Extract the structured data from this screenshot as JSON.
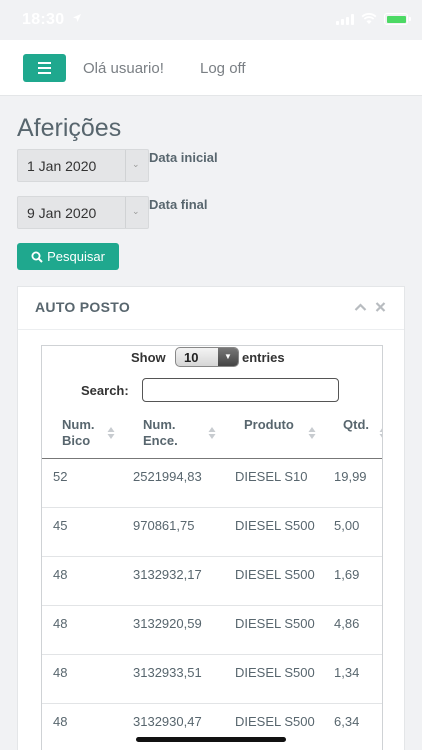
{
  "status_bar": {
    "time": "18:30"
  },
  "header": {
    "greeting": "Olá usuario!",
    "logoff": "Log off"
  },
  "page": {
    "title": "Aferições"
  },
  "filters": {
    "start_date": "1 Jan 2020",
    "start_label": "Data inicial",
    "end_date": "9 Jan 2020",
    "end_label": "Data final",
    "search_button": "Pesquisar"
  },
  "panel": {
    "title": "AUTO POSTO",
    "length_show": "Show",
    "length_value": "10",
    "length_entries": "entries",
    "search_label": "Search:"
  },
  "table": {
    "columns": [
      {
        "line1": "Num.",
        "line2": "Bico"
      },
      {
        "line1": "Num.",
        "line2": "Ence."
      },
      {
        "line1": "Produto",
        "line2": ""
      },
      {
        "line1": "Qtd.",
        "line2": ""
      }
    ],
    "rows": [
      {
        "bico": "52",
        "ence": "2521994,83",
        "produto": "DIESEL S10",
        "qtd": "19,99"
      },
      {
        "bico": "45",
        "ence": "970861,75",
        "produto": "DIESEL S500",
        "qtd": "5,00"
      },
      {
        "bico": "48",
        "ence": "3132932,17",
        "produto": "DIESEL S500",
        "qtd": "1,69"
      },
      {
        "bico": "48",
        "ence": "3132920,59",
        "produto": "DIESEL S500",
        "qtd": "4,86"
      },
      {
        "bico": "48",
        "ence": "3132933,51",
        "produto": "DIESEL S500",
        "qtd": "1,34"
      },
      {
        "bico": "48",
        "ence": "3132930,47",
        "produto": "DIESEL S500",
        "qtd": "6,34"
      }
    ]
  },
  "colors": {
    "accent": "#1fa88e",
    "text": "#58666e",
    "background": "#f1f2f4"
  }
}
